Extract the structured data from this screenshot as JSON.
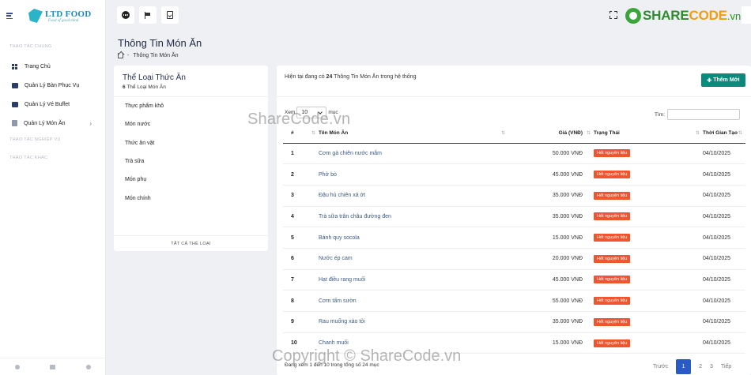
{
  "brand": {
    "name": "LTD FOOD",
    "tagline": "Food of good mind"
  },
  "sidebar": {
    "section_main": "THAO TÁC CHUNG",
    "items": [
      {
        "label": "Trang Chủ",
        "icon": "grid-icon"
      },
      {
        "label": "Quản Lý Bàn Phục Vụ",
        "icon": "table-icon"
      },
      {
        "label": "Quản Lý Vé Buffet",
        "icon": "ticket-icon"
      },
      {
        "label": "Quản Lý Món Ăn",
        "icon": "clipboard-icon"
      }
    ],
    "section_staff": "THAO TÁC NGHIỆP VỤ",
    "section_other": "THAO TÁC KHÁC"
  },
  "watermark": {
    "brand_a": "SHARE",
    "brand_b": "CODE",
    "brand_c": ".vn",
    "text_top": "ShareCode.vn",
    "text_bottom": "Copyright © ShareCode.vn"
  },
  "page": {
    "title": "Thông Tin Món Ăn",
    "breadcrumb": "Thông Tin Món Ăn",
    "breadcrumb_sep": "-"
  },
  "categories": {
    "title": "Thể Loại Thức Ăn",
    "count": "6",
    "count_suffix": "Thể Loại Món Ăn",
    "items": [
      "Thực phẩm khô",
      "Món nước",
      "Thức ăn vặt",
      "Trà sữa",
      "Món phụ",
      "Món chính"
    ],
    "footer": "TẤT CẢ THỂ LOẠI"
  },
  "main": {
    "info_prefix": "Hiện tại đang có",
    "info_count": "24",
    "info_suffix": "Thông Tin Món Ăn trong hệ thống",
    "add_label": "Thêm Mới",
    "show_label": "Xem",
    "show_value": "10",
    "show_suffix": "mục",
    "search_label": "Tìm:",
    "columns": {
      "no": "#",
      "name": "Tên Món Ăn",
      "price": "Giá (VNĐ)",
      "status": "Trạng Thái",
      "created": "Thời Gian Tạo"
    },
    "rows": [
      {
        "no": "1",
        "name": "Cơm gà chiên nước mắm",
        "price": "50.000 VNĐ",
        "status": "Hết nguyên liệu",
        "created": "04/10/2025"
      },
      {
        "no": "2",
        "name": "Phở bò",
        "price": "45.000 VNĐ",
        "status": "Hết nguyên liệu",
        "created": "04/10/2025"
      },
      {
        "no": "3",
        "name": "Đậu hủ chiên xả ớt",
        "price": "35.000 VNĐ",
        "status": "Hết nguyên liệu",
        "created": "04/10/2025"
      },
      {
        "no": "4",
        "name": "Trà sữa trân châu đường đen",
        "price": "35.000 VNĐ",
        "status": "Hết nguyên liệu",
        "created": "04/10/2025"
      },
      {
        "no": "5",
        "name": "Bánh quy socola",
        "price": "15.000 VNĐ",
        "status": "Hết nguyên liệu",
        "created": "04/10/2025"
      },
      {
        "no": "6",
        "name": "Nước ép cam",
        "price": "20.000 VNĐ",
        "status": "Hết nguyên liệu",
        "created": "04/10/2025"
      },
      {
        "no": "7",
        "name": "Hạt điều rang muối",
        "price": "45.000 VNĐ",
        "status": "Hết nguyên liệu",
        "created": "04/10/2025"
      },
      {
        "no": "8",
        "name": "Cơm tấm sườn",
        "price": "55.000 VNĐ",
        "status": "Hết nguyên liệu",
        "created": "04/10/2025"
      },
      {
        "no": "9",
        "name": "Rau muống xào tỏi",
        "price": "35.000 VNĐ",
        "status": "Hết nguyên liệu",
        "created": "04/10/2025"
      },
      {
        "no": "10",
        "name": "Chanh muối",
        "price": "15.000 VNĐ",
        "status": "Hết nguyên liệu",
        "created": "04/10/2025"
      }
    ],
    "footer_text": "Đang xem 1 đến 10 trong tổng số 24 mục",
    "pager": {
      "prev": "Trước",
      "pages": [
        "1",
        "2",
        "3"
      ],
      "next": "Tiếp"
    }
  },
  "colors": {
    "primary": "#2a5ac6",
    "add_button": "#0a8a7a",
    "badge_danger": "#f0552d"
  }
}
